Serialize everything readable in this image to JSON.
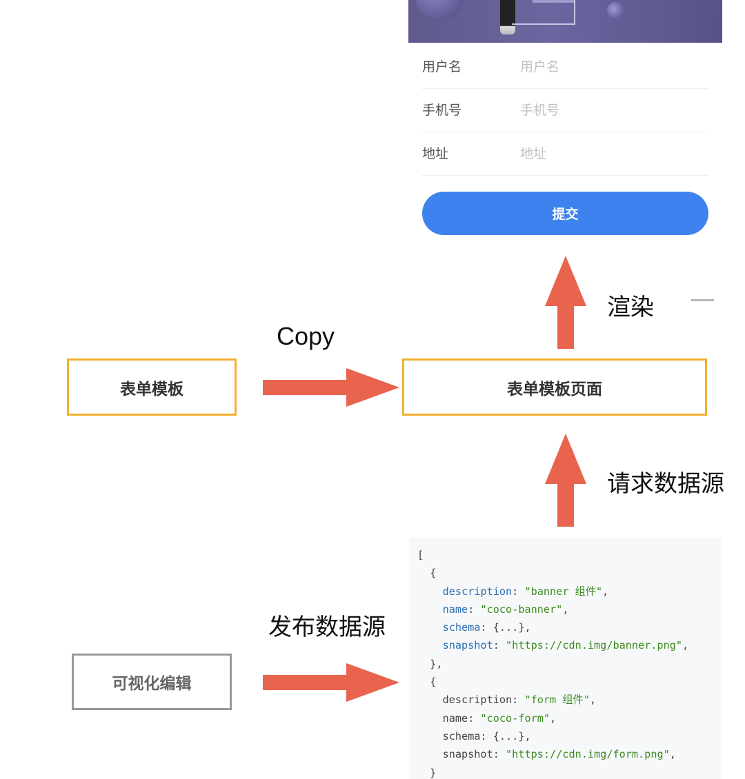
{
  "form": {
    "fields": [
      {
        "label": "用户名",
        "placeholder": "用户名"
      },
      {
        "label": "手机号",
        "placeholder": "手机号"
      },
      {
        "label": "地址",
        "placeholder": "地址"
      }
    ],
    "submit_label": "提交"
  },
  "nodes": {
    "template": "表单模板",
    "template_page": "表单模板页面",
    "visual_edit": "可视化编辑"
  },
  "edges": {
    "copy": "Copy",
    "render": "渲染",
    "request": "请求数据源",
    "publish": "发布数据源"
  },
  "code": {
    "open": "[",
    "close_array": "]",
    "items": [
      {
        "description": "\"banner 组件\"",
        "name": "\"coco-banner\"",
        "schema": "{...}",
        "snapshot": "\"https://cdn.img/banner.png\""
      },
      {
        "description": "\"form 组件\"",
        "name": "\"coco-form\"",
        "schema": "{...}",
        "snapshot": "\"https://cdn.img/form.png\""
      }
    ]
  },
  "colors": {
    "arrow": "#e8644f",
    "box_border_orange": "#f2b02f",
    "box_border_gray": "#999999",
    "button": "#3d82ee"
  }
}
